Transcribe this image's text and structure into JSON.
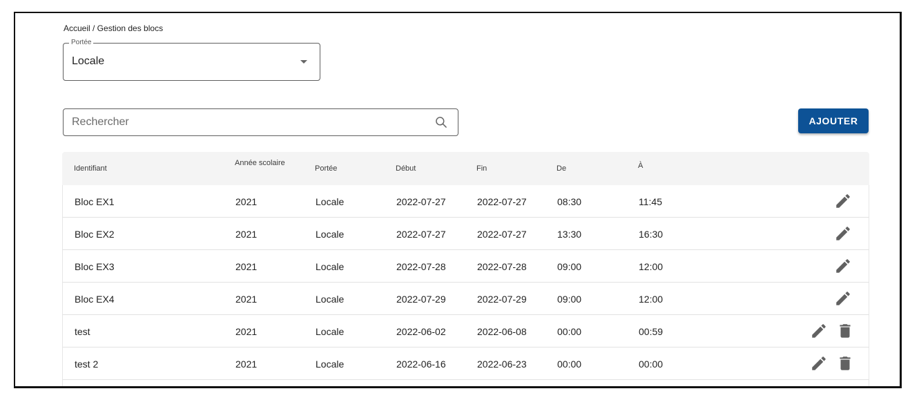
{
  "breadcrumb": "Accueil / Gestion des blocs",
  "scope_select": {
    "legend": "Portée",
    "value": "Locale"
  },
  "search": {
    "placeholder": "Rechercher"
  },
  "add_button": "AJOUTER",
  "colors": {
    "primary": "#0d5296",
    "header_bg": "#f4f4f4",
    "icon": "#616161"
  },
  "table": {
    "headers": [
      "Identifiant",
      "Année scolaire",
      "Portée",
      "Début",
      "Fin",
      "De",
      "À"
    ],
    "rows": [
      {
        "cells": [
          "Bloc EX1",
          "2021",
          "Locale",
          "2022-07-27",
          "2022-07-27",
          "08:30",
          "11:45"
        ],
        "actions": [
          "edit-icon"
        ]
      },
      {
        "cells": [
          "Bloc EX2",
          "2021",
          "Locale",
          "2022-07-27",
          "2022-07-27",
          "13:30",
          "16:30"
        ],
        "actions": [
          "edit-icon"
        ]
      },
      {
        "cells": [
          "Bloc EX3",
          "2021",
          "Locale",
          "2022-07-28",
          "2022-07-28",
          "09:00",
          "12:00"
        ],
        "actions": [
          "edit-icon"
        ]
      },
      {
        "cells": [
          "Bloc EX4",
          "2021",
          "Locale",
          "2022-07-29",
          "2022-07-29",
          "09:00",
          "12:00"
        ],
        "actions": [
          "edit-icon"
        ]
      },
      {
        "cells": [
          "test",
          "2021",
          "Locale",
          "2022-06-02",
          "2022-06-08",
          "00:00",
          "00:59"
        ],
        "actions": [
          "edit-icon",
          "delete-icon"
        ]
      },
      {
        "cells": [
          "test 2",
          "2021",
          "Locale",
          "2022-06-16",
          "2022-06-23",
          "00:00",
          "00:00"
        ],
        "actions": [
          "edit-icon",
          "delete-icon"
        ]
      }
    ]
  }
}
